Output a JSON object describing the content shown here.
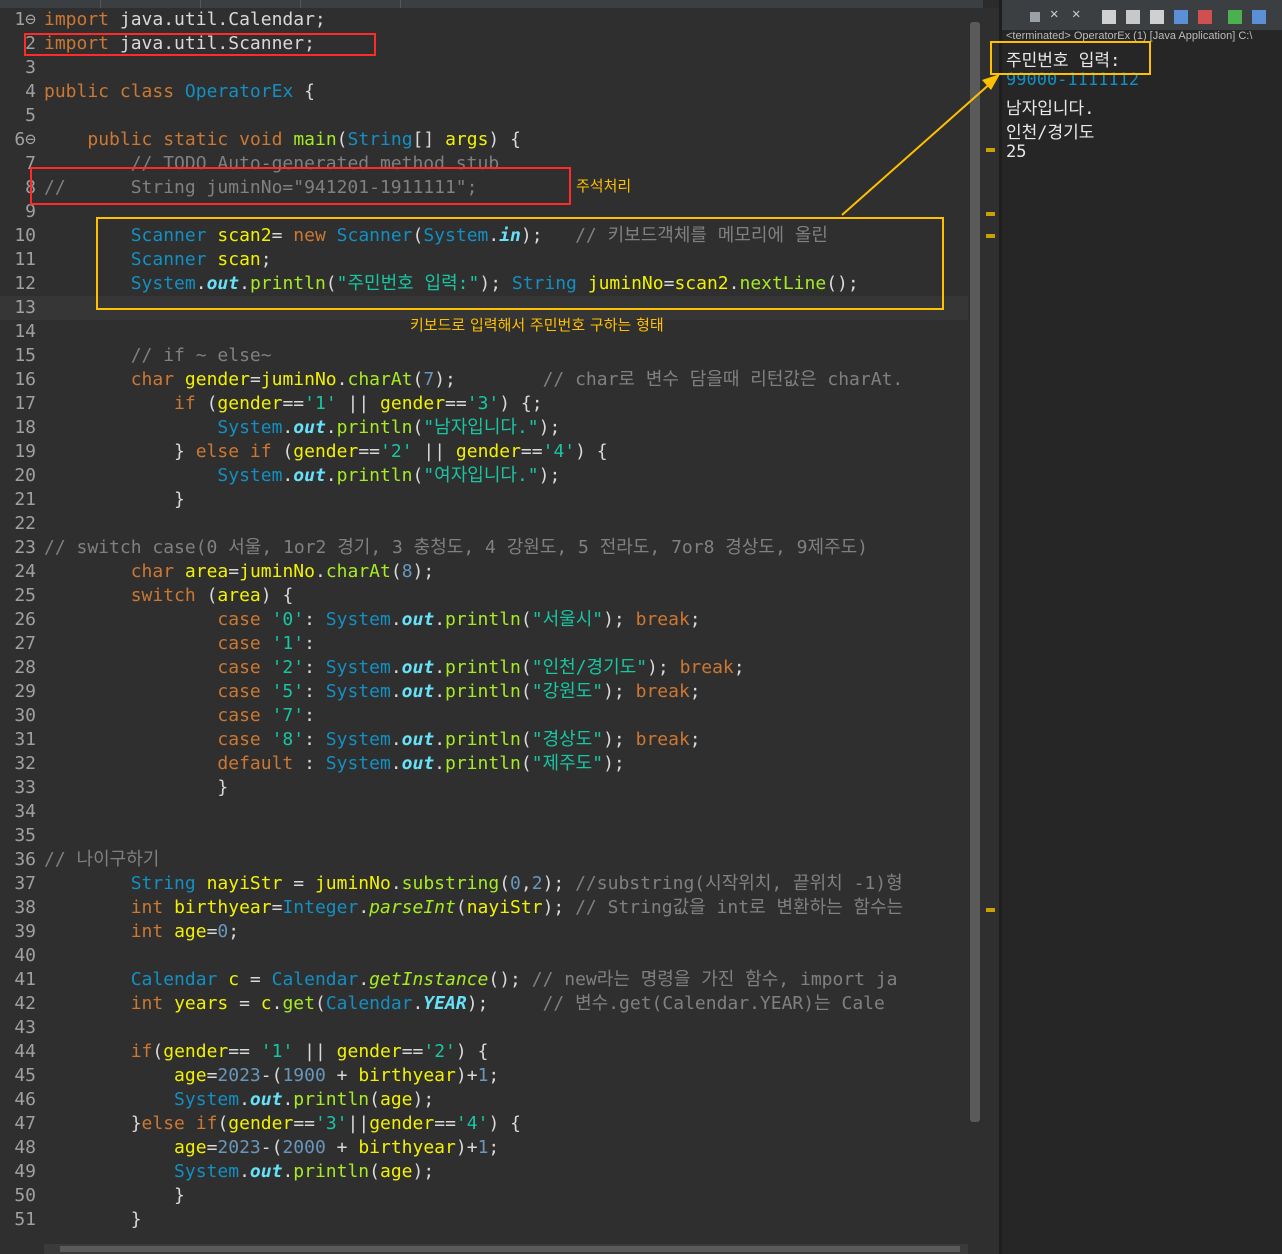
{
  "editor": {
    "lines": [
      {
        "n": "1",
        "fold": "⊖",
        "html": "<span class=\"kw\">import</span> java.util.Calendar;"
      },
      {
        "n": "2",
        "html": "<span class=\"kw\">import</span> java.util.Scanner;"
      },
      {
        "n": "3",
        "html": ""
      },
      {
        "n": "4",
        "html": "<span class=\"kw\">public</span> <span class=\"kw\">class</span> <span class=\"cls\">OperatorEx</span> {"
      },
      {
        "n": "5",
        "html": ""
      },
      {
        "n": "6",
        "fold": "⊖",
        "html": "    <span class=\"kw\">public</span> <span class=\"kw\">static</span> <span class=\"kw\">void</span> <span class=\"mth\">main</span>(<span class=\"cls\">String</span>[] <span class=\"var\">args</span>) {"
      },
      {
        "n": "7",
        "html": "        <span class=\"cm\">// TODO Auto-generated method stub</span>"
      },
      {
        "n": "8",
        "html": "<span class=\"cm\">//      String juminNo=\"941201-1911111\";</span>"
      },
      {
        "n": "9",
        "html": ""
      },
      {
        "n": "10",
        "html": "        <span class=\"cls\">Scanner</span> <span class=\"var\">scan2</span>= <span class=\"kw\">new</span> <span class=\"cls\">Scanner</span>(<span class=\"cls\">System</span>.<span class=\"fld\">in</span>);   <span class=\"cm\">// 키보드객체를 메모리에 올린</span>"
      },
      {
        "n": "11",
        "html": "        <span class=\"cls\">Scanner</span> <span class=\"var\">scan</span>;"
      },
      {
        "n": "12",
        "html": "        <span class=\"cls\">System</span>.<span class=\"fld\">out</span>.<span class=\"mth\">println</span>(<span class=\"str\">\"주민번호 입력:\"</span>); <span class=\"cls\">String</span> <span class=\"var\">juminNo</span>=<span class=\"var\">scan2</span>.<span class=\"mth\">nextLine</span>();"
      },
      {
        "n": "13",
        "html": "",
        "cur": true
      },
      {
        "n": "14",
        "html": ""
      },
      {
        "n": "15",
        "html": "        <span class=\"cm\">// if ~ else~</span>"
      },
      {
        "n": "16",
        "html": "        <span class=\"kw\">char</span> <span class=\"var\">gender</span>=<span class=\"var\">juminNo</span>.<span class=\"mth\">charAt</span>(<span class=\"num2\">7</span>);        <span class=\"cm\">// char로 변수 담을때 리턴값은 charAt.</span>"
      },
      {
        "n": "17",
        "html": "            <span class=\"kw\">if</span> (<span class=\"var\">gender</span>==<span class=\"str\">'1'</span> || <span class=\"var\">gender</span>==<span class=\"str\">'3'</span>) {;"
      },
      {
        "n": "18",
        "html": "                <span class=\"cls\">System</span>.<span class=\"fld\">out</span>.<span class=\"mth\">println</span>(<span class=\"str\">\"남자입니다.\"</span>);"
      },
      {
        "n": "19",
        "html": "            } <span class=\"kw\">else</span> <span class=\"kw\">if</span> (<span class=\"var\">gender</span>==<span class=\"str\">'2'</span> || <span class=\"var\">gender</span>==<span class=\"str\">'4'</span>) {"
      },
      {
        "n": "20",
        "html": "                <span class=\"cls\">System</span>.<span class=\"fld\">out</span>.<span class=\"mth\">println</span>(<span class=\"str\">\"여자입니다.\"</span>);"
      },
      {
        "n": "21",
        "html": "            }"
      },
      {
        "n": "22",
        "html": ""
      },
      {
        "n": "23",
        "html": "<span class=\"cm\">// switch case(0 서울, 1or2 경기, 3 충청도, 4 강원도, 5 전라도, 7or8 경상도, 9제주도)</span>"
      },
      {
        "n": "24",
        "html": "        <span class=\"kw\">char</span> <span class=\"var\">area</span>=<span class=\"var\">juminNo</span>.<span class=\"mth\">charAt</span>(<span class=\"num2\">8</span>);"
      },
      {
        "n": "25",
        "html": "        <span class=\"kw\">switch</span> (<span class=\"var\">area</span>) {"
      },
      {
        "n": "26",
        "html": "                <span class=\"kw\">case</span> <span class=\"str\">'0'</span>: <span class=\"cls\">System</span>.<span class=\"fld\">out</span>.<span class=\"mth\">println</span>(<span class=\"str\">\"서울시\"</span>); <span class=\"kw\">break</span>;"
      },
      {
        "n": "27",
        "html": "                <span class=\"kw\">case</span> <span class=\"str\">'1'</span>:"
      },
      {
        "n": "28",
        "html": "                <span class=\"kw\">case</span> <span class=\"str\">'2'</span>: <span class=\"cls\">System</span>.<span class=\"fld\">out</span>.<span class=\"mth\">println</span>(<span class=\"str\">\"인천/경기도\"</span>); <span class=\"kw\">break</span>;"
      },
      {
        "n": "29",
        "html": "                <span class=\"kw\">case</span> <span class=\"str\">'5'</span>: <span class=\"cls\">System</span>.<span class=\"fld\">out</span>.<span class=\"mth\">println</span>(<span class=\"str\">\"강원도\"</span>); <span class=\"kw\">break</span>;"
      },
      {
        "n": "30",
        "html": "                <span class=\"kw\">case</span> <span class=\"str\">'7'</span>:"
      },
      {
        "n": "31",
        "html": "                <span class=\"kw\">case</span> <span class=\"str\">'8'</span>: <span class=\"cls\">System</span>.<span class=\"fld\">out</span>.<span class=\"mth\">println</span>(<span class=\"str\">\"경상도\"</span>); <span class=\"kw\">break</span>;"
      },
      {
        "n": "32",
        "html": "                <span class=\"kw\">default</span> : <span class=\"cls\">System</span>.<span class=\"fld\">out</span>.<span class=\"mth\">println</span>(<span class=\"str\">\"제주도\"</span>);"
      },
      {
        "n": "33",
        "html": "                }"
      },
      {
        "n": "34",
        "html": ""
      },
      {
        "n": "35",
        "html": ""
      },
      {
        "n": "36",
        "html": "<span class=\"cm\">// 나이구하기</span>"
      },
      {
        "n": "37",
        "html": "        <span class=\"cls\">String</span> <span class=\"var\">nayiStr</span> = <span class=\"var\">juminNo</span>.<span class=\"mth\">substring</span>(<span class=\"num2\">0</span>,<span class=\"num2\">2</span>); <span class=\"cm\">//substring(시작위치, 끝위치 -1)형</span>"
      },
      {
        "n": "38",
        "html": "        <span class=\"kw\">int</span> <span class=\"var\">birthyear</span>=<span class=\"cls\">Integer</span>.<span class=\"it\">parseInt</span>(<span class=\"var\">nayiStr</span>); <span class=\"cm\">// String값을 int로 변환하는 함수는</span>"
      },
      {
        "n": "39",
        "html": "        <span class=\"kw\">int</span> <span class=\"var\">age</span>=<span class=\"num2\">0</span>;"
      },
      {
        "n": "40",
        "html": ""
      },
      {
        "n": "41",
        "html": "        <span class=\"cls\">Calendar</span> <span class=\"var\">c</span> = <span class=\"cls\">Calendar</span>.<span class=\"it\">getInstance</span>(); <span class=\"cm\">// new라는 명령을 가진 함수, import ja</span>"
      },
      {
        "n": "42",
        "html": "        <span class=\"kw\">int</span> <span class=\"var\">years</span> = <span class=\"var\">c</span>.<span class=\"mth\">get</span>(<span class=\"cls\">Calendar</span>.<span class=\"fld\">YEAR</span>);     <span class=\"cm\">// 변수.get(Calendar.YEAR)는 Cale</span>"
      },
      {
        "n": "43",
        "html": ""
      },
      {
        "n": "44",
        "html": "        <span class=\"kw\">if</span>(<span class=\"var\">gender</span>== <span class=\"str\">'1'</span> || <span class=\"var\">gender</span>==<span class=\"str\">'2'</span>) {"
      },
      {
        "n": "45",
        "html": "            <span class=\"var\">age</span>=<span class=\"num2\">2023</span>-(<span class=\"num2\">1900</span> + <span class=\"var\">birthyear</span>)+<span class=\"num2\">1</span>;"
      },
      {
        "n": "46",
        "html": "            <span class=\"cls\">System</span>.<span class=\"fld\">out</span>.<span class=\"mth\">println</span>(<span class=\"var\">age</span>);"
      },
      {
        "n": "47",
        "html": "        }<span class=\"kw\">else</span> <span class=\"kw\">if</span>(<span class=\"var\">gender</span>==<span class=\"str\">'3'</span>||<span class=\"var\">gender</span>==<span class=\"str\">'4'</span>) {"
      },
      {
        "n": "48",
        "html": "            <span class=\"var\">age</span>=<span class=\"num2\">2023</span>-(<span class=\"num2\">2000</span> + <span class=\"var\">birthyear</span>)+<span class=\"num2\">1</span>;"
      },
      {
        "n": "49",
        "html": "            <span class=\"cls\">System</span>.<span class=\"fld\">out</span>.<span class=\"mth\">println</span>(<span class=\"var\">age</span>);"
      },
      {
        "n": "50",
        "html": "            }"
      },
      {
        "n": "51",
        "html": "        }"
      }
    ]
  },
  "console": {
    "status": "<terminated> OperatorEx (1) [Java Application] C:\\",
    "lines": [
      {
        "text": "주민번호 입력:",
        "input": false
      },
      {
        "text": "99000-1111112",
        "input": true
      },
      {
        "text": "남자입니다.",
        "input": false
      },
      {
        "text": "인천/경기도",
        "input": false
      },
      {
        "text": "25",
        "input": false
      }
    ]
  },
  "annotations": {
    "comment_label": "주석처리",
    "keyboard_label": "키보드로 입력해서 주민번호 구하는 형태"
  },
  "toolbar_icons": [
    "stop-icon",
    "remove-launch-icon",
    "remove-all-icon",
    "scroll-lock-icon",
    "word-wrap-icon",
    "show-console-icon",
    "pin-console-icon",
    "display-selected-console-icon",
    "new-console-icon",
    "open-console-icon"
  ],
  "colors": {
    "annotation_red": "#ff2b2b",
    "annotation_yellow": "#ffc000"
  }
}
